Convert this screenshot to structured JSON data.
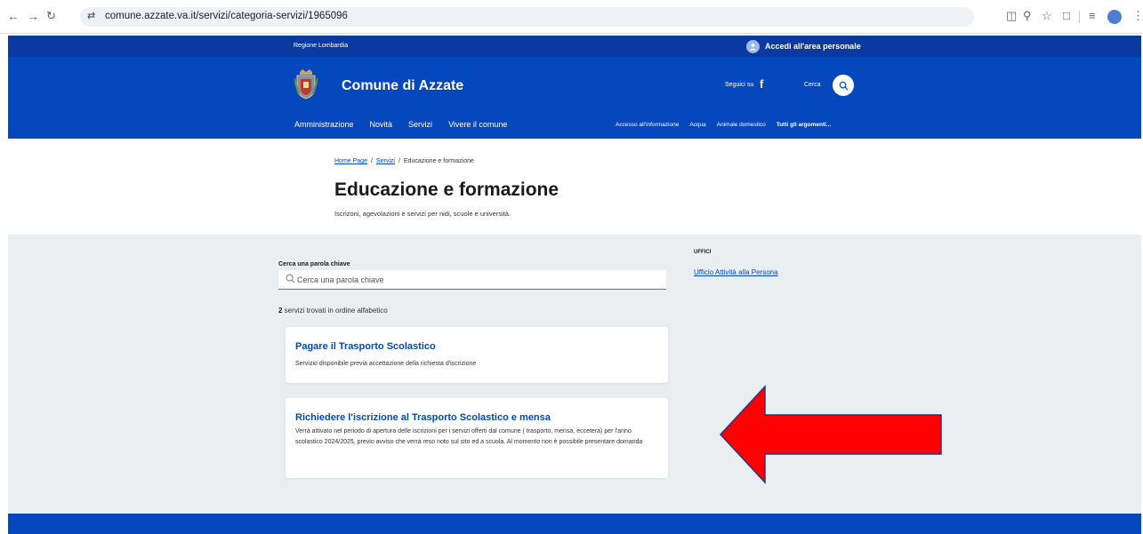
{
  "browser": {
    "url": "comune.azzate.va.it/servizi/categoria-servizi/1965096"
  },
  "slim_header": {
    "region": "Regione Lombardia",
    "login_label": "Accedi all'area personale"
  },
  "header": {
    "site_title": "Comune di Azzate",
    "social_label": "Seguici su",
    "search_label": "Cerca"
  },
  "main_nav": [
    "Amministrazione",
    "Novità",
    "Servizi",
    "Vivere il comune"
  ],
  "sub_nav": [
    "Accesso all'informazione",
    "Acqua",
    "Animale domestico",
    "Tutti gli argomenti..."
  ],
  "breadcrumb": {
    "home": "Home Page",
    "services": "Servizi",
    "current": "Educazione e formazione"
  },
  "page": {
    "title": "Educazione e formazione",
    "subtitle": "Iscrizoni, agevolazioni e servizi per nidi, scuole e università."
  },
  "search": {
    "label": "Cerca una parola chiave",
    "placeholder": "Cerca una parola chiave"
  },
  "results": {
    "count": "2",
    "count_text": " servizi trovati in ordine alfabetico"
  },
  "cards": [
    {
      "title": "Pagare il Trasporto Scolastico",
      "description": "Servizio disponibile previa accettazione della richiesta d'iscrizione"
    },
    {
      "title": "Richiedere l'iscrizione al Trasporto Scolastico e mensa",
      "description": "Verrà attivato nel periodo di apertura delle iscrizioni per i servizi offerti dal comune ( trasporto, mensa, eccetera) per l'anno scolastico 2024/2025, previo avviso che verrà reso noto sul sito ed a scuola. Al momento non è possibile presentare domanda"
    }
  ],
  "sidebar": {
    "heading": "UFFICI",
    "office": "Ufficio Attività alla Persona"
  },
  "colors": {
    "slim_header": "#0a3a9f",
    "header": "#0547bd",
    "grey_bg": "#ebeef1",
    "arrow": "#ff0000"
  }
}
